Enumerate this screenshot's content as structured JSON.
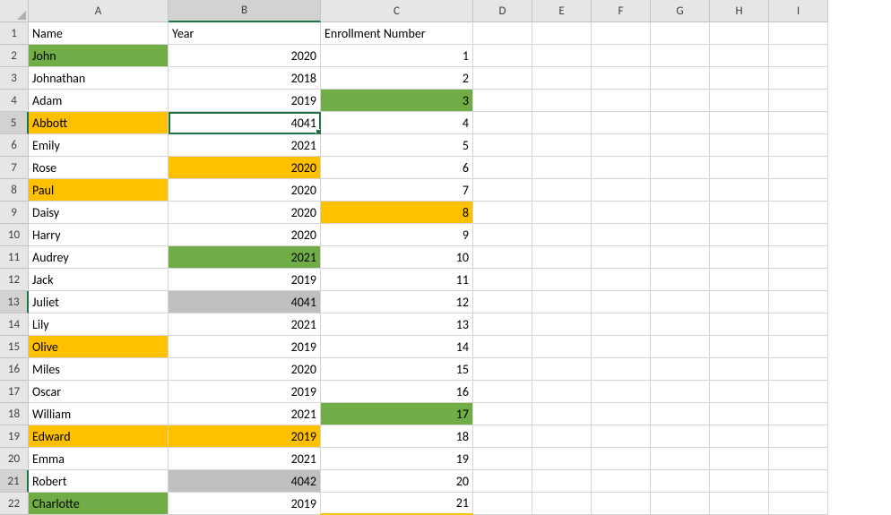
{
  "columns": [
    "A",
    "B",
    "C",
    "D",
    "E",
    "F",
    "G",
    "H",
    "I"
  ],
  "row_numbers": [
    1,
    2,
    3,
    4,
    5,
    6,
    7,
    8,
    9,
    10,
    11,
    12,
    13,
    14,
    15,
    16,
    17,
    18,
    19,
    20,
    21,
    22
  ],
  "headers": {
    "A": "Name",
    "B": "Year",
    "C": "Enrollment Number"
  },
  "rows": [
    {
      "A": "John",
      "B": "2020",
      "C": "1",
      "fillA": "green"
    },
    {
      "A": "Johnathan",
      "B": "2018",
      "C": "2"
    },
    {
      "A": "Adam",
      "B": "2019",
      "C": "3",
      "fillC": "green"
    },
    {
      "A": "Abbott",
      "B": "4041",
      "C": "4",
      "fillA": "orange"
    },
    {
      "A": "Emily",
      "B": "2021",
      "C": "5"
    },
    {
      "A": "Rose",
      "B": "2020",
      "C": "6",
      "fillB": "orange"
    },
    {
      "A": "Paul",
      "B": "2020",
      "C": "7",
      "fillA": "orange"
    },
    {
      "A": "Daisy",
      "B": "2020",
      "C": "8",
      "fillC": "orange"
    },
    {
      "A": "Harry",
      "B": "2020",
      "C": "9"
    },
    {
      "A": "Audrey",
      "B": "2021",
      "C": "10",
      "fillB": "green"
    },
    {
      "A": "Jack",
      "B": "2019",
      "C": "11"
    },
    {
      "A": "Juliet",
      "B": "4041",
      "C": "12",
      "fillB": "gray"
    },
    {
      "A": "Lily",
      "B": "2021",
      "C": "13"
    },
    {
      "A": "Olive",
      "B": "2019",
      "C": "14",
      "fillA": "orange"
    },
    {
      "A": "Miles",
      "B": "2020",
      "C": "15"
    },
    {
      "A": "Oscar",
      "B": "2019",
      "C": "16"
    },
    {
      "A": "William",
      "B": "2021",
      "C": "17",
      "fillC": "green"
    },
    {
      "A": "Edward",
      "B": "2019",
      "C": "18",
      "fillA": "orange",
      "fillB": "orange"
    },
    {
      "A": "Emma",
      "B": "2021",
      "C": "19"
    },
    {
      "A": "Robert",
      "B": "4042",
      "C": "20",
      "fillB": "gray"
    },
    {
      "A": "Charlotte",
      "B": "2019",
      "C": "21",
      "fillA": "green"
    }
  ],
  "active_cell": "B5",
  "active_column": "B",
  "green_tinge_rows": [
    5,
    13,
    21
  ],
  "chart_data": {
    "type": "table",
    "columns": [
      "Name",
      "Year",
      "Enrollment Number"
    ],
    "data": [
      [
        "John",
        2020,
        1
      ],
      [
        "Johnathan",
        2018,
        2
      ],
      [
        "Adam",
        2019,
        3
      ],
      [
        "Abbott",
        4041,
        4
      ],
      [
        "Emily",
        2021,
        5
      ],
      [
        "Rose",
        2020,
        6
      ],
      [
        "Paul",
        2020,
        7
      ],
      [
        "Daisy",
        2020,
        8
      ],
      [
        "Harry",
        2020,
        9
      ],
      [
        "Audrey",
        2021,
        10
      ],
      [
        "Jack",
        2019,
        11
      ],
      [
        "Juliet",
        4041,
        12
      ],
      [
        "Lily",
        2021,
        13
      ],
      [
        "Olive",
        2019,
        14
      ],
      [
        "Miles",
        2020,
        15
      ],
      [
        "Oscar",
        2019,
        16
      ],
      [
        "William",
        2021,
        17
      ],
      [
        "Edward",
        2019,
        18
      ],
      [
        "Emma",
        2021,
        19
      ],
      [
        "Robert",
        4042,
        20
      ],
      [
        "Charlotte",
        2019,
        21
      ]
    ]
  }
}
